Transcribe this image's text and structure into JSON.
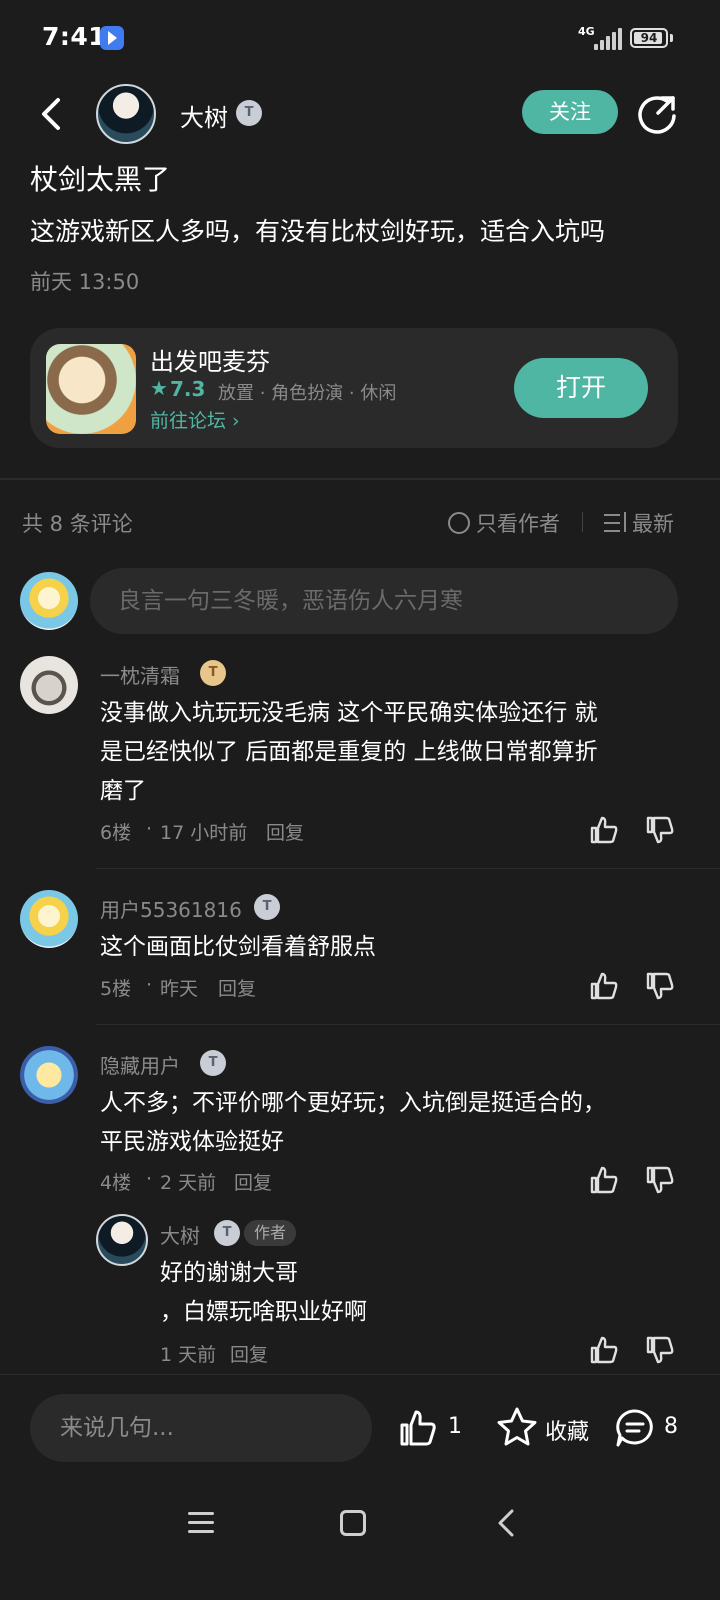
{
  "status_bar": {
    "time": "7:41",
    "network": "4G",
    "battery": "94",
    "battery_level": 0.94
  },
  "header": {
    "author_name": "大树",
    "author_badge": "T",
    "follow_label": "关注"
  },
  "post": {
    "title": "杖剑太黑了",
    "body": "这游戏新区人多吗，有没有比杖剑好玩，适合入坑吗",
    "time": "前天 13:50"
  },
  "game_card": {
    "name": "出发吧麦芬",
    "rating": "7.3",
    "tags": "放置 · 角色扮演 · 休闲",
    "forum_link": "前往论坛",
    "open_label": "打开"
  },
  "comments_header": {
    "count_text": "共 8 条评论",
    "author_only": "只看作者",
    "sort": "最新"
  },
  "comment_input": {
    "placeholder": "良言一句三冬暖，恶语伤人六月寒"
  },
  "comments": [
    {
      "name": "一枕清霜",
      "badge": "T",
      "line1": "没事做入坑玩玩没毛病 这个平民确实体验还行 就",
      "line2": "是已经快似了 后面都是重复的 上线做日常都算折",
      "line3": "磨了",
      "floor": "6楼",
      "time": "17 小时前",
      "reply": "回复"
    },
    {
      "name": "用户55361816",
      "badge": "T",
      "line1": "这个画面比仗剑看着舒服点",
      "floor": "5楼",
      "time": "昨天",
      "reply": "回复"
    },
    {
      "name": "隐藏用户",
      "badge": "T",
      "line1": "人不多；不评价哪个更好玩；入坑倒是挺适合的，",
      "line2": "平民游戏体验挺好",
      "floor": "4楼",
      "time": "2 天前",
      "reply": "回复",
      "sub_reply": {
        "name": "大树",
        "badge": "T",
        "author_tag": "作者",
        "line1": "好的谢谢大哥",
        "line2": "，白嫖玩啥职业好啊",
        "time": "1 天前",
        "reply": "回复"
      }
    }
  ],
  "bottom_bar": {
    "reply_placeholder": "来说几句...",
    "like_count": "1",
    "favorite_label": "收藏",
    "comment_count": "8"
  },
  "colors": {
    "background": "#1c1c1c",
    "accent": "#4fb6a4",
    "card": "#2a2a2a",
    "muted_text": "#8a8a8a"
  }
}
